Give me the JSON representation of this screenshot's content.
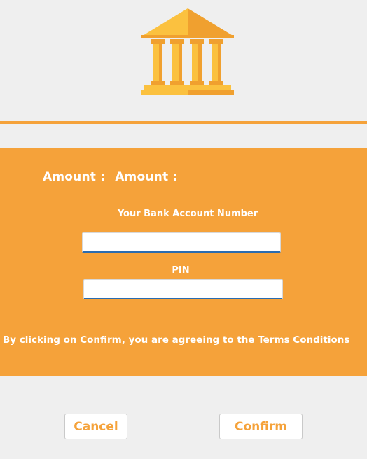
{
  "icons": {
    "bank": "bank-building-icon"
  },
  "colors": {
    "accent": "#f5a23a",
    "icon_light": "#fbc13f",
    "icon_dark": "#f0a02f",
    "background": "#efefef",
    "input_underline": "#2a6cb0"
  },
  "payment": {
    "amount_label": "Amount :",
    "amount_value": "Amount :"
  },
  "form": {
    "account_label": "Your Bank Account Number",
    "account_value": "",
    "pin_label": "PIN",
    "pin_value": ""
  },
  "terms_text": "By clicking on Confirm, you are agreeing to the Terms Conditions",
  "buttons": {
    "cancel": "Cancel",
    "confirm": "Confirm"
  }
}
